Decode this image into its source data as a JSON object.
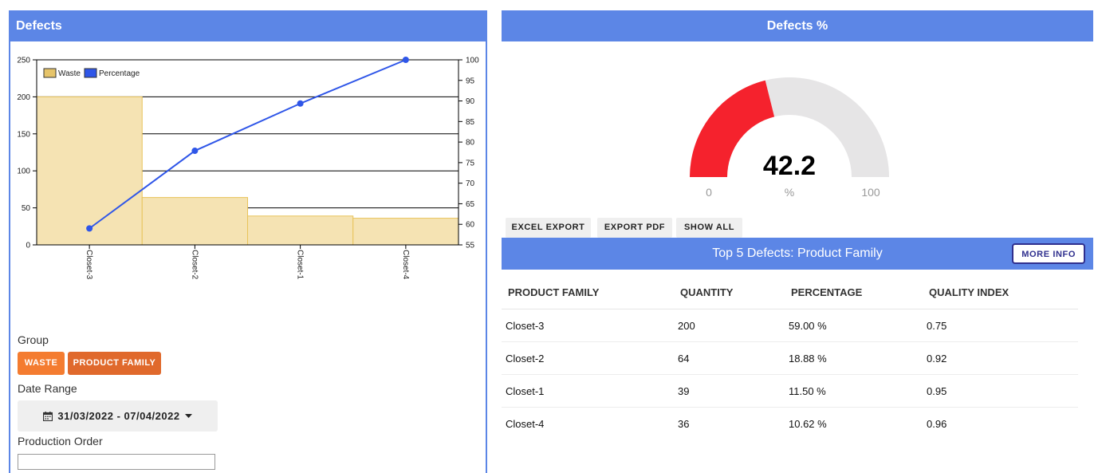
{
  "left_panel": {
    "title": "Defects"
  },
  "right_panel": {
    "title": "Defects %"
  },
  "chart_data": {
    "type": "bar",
    "categories": [
      "Closet-3",
      "Closet-2",
      "Closet-1",
      "Closet-4"
    ],
    "series": [
      {
        "name": "Waste",
        "type": "bar",
        "axis": "left",
        "values": [
          200,
          64,
          39,
          36
        ],
        "color": "#f5e3b3",
        "border": "#e8c35a"
      },
      {
        "name": "Percentage",
        "type": "line",
        "axis": "right",
        "values": [
          59.0,
          77.88,
          89.38,
          100.0
        ],
        "color": "#2f56e8"
      }
    ],
    "ylim": [
      0,
      250
    ],
    "yticks": [
      "0",
      "50",
      "100",
      "150",
      "200",
      "250"
    ],
    "y2lim": [
      55,
      100
    ],
    "y2ticks": [
      "55",
      "60",
      "65",
      "70",
      "75",
      "80",
      "85",
      "90",
      "95",
      "100"
    ],
    "legend": "top-left",
    "grid": true
  },
  "gauge": {
    "value": "42.2",
    "unit": "%",
    "min": "0",
    "max": "100",
    "fraction": 0.422,
    "fill_color": "#f5222d",
    "track_color": "#e6e5e6"
  },
  "toolbar": {
    "excel": "EXCEL EXPORT",
    "pdf": "EXPORT PDF",
    "show_all": "SHOW ALL"
  },
  "top5": {
    "title": "Top 5 Defects: Product Family",
    "more_info": "MORE INFO",
    "columns": [
      "PRODUCT FAMILY",
      "QUANTITY",
      "PERCENTAGE",
      "QUALITY INDEX"
    ],
    "rows": [
      [
        "Closet-3",
        "200",
        "59.00 %",
        "0.75"
      ],
      [
        "Closet-2",
        "64",
        "18.88 %",
        "0.92"
      ],
      [
        "Closet-1",
        "39",
        "11.50 %",
        "0.95"
      ],
      [
        "Closet-4",
        "36",
        "10.62 %",
        "0.96"
      ]
    ]
  },
  "filters": {
    "group_label": "Group",
    "group_buttons": [
      {
        "label": "WASTE",
        "color": "#f47c30"
      },
      {
        "label": "PRODUCT FAMILY",
        "color": "#e0692c"
      }
    ],
    "date_label": "Date Range",
    "date_value": "31/03/2022 - 07/04/2022",
    "po_label": "Production Order"
  },
  "colors": {
    "accent": "#5c86e6"
  }
}
